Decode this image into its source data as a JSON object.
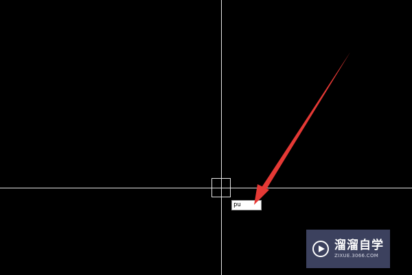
{
  "command_input": {
    "value": "pu"
  },
  "watermark": {
    "title": "溜溜自学",
    "subtitle": "ZIXUE.3066.COM",
    "icon": "play-icon"
  },
  "colors": {
    "background": "#000000",
    "crosshair": "#e8e8e8",
    "arrow": "#e53935",
    "watermark_bg": "#464c6e"
  }
}
